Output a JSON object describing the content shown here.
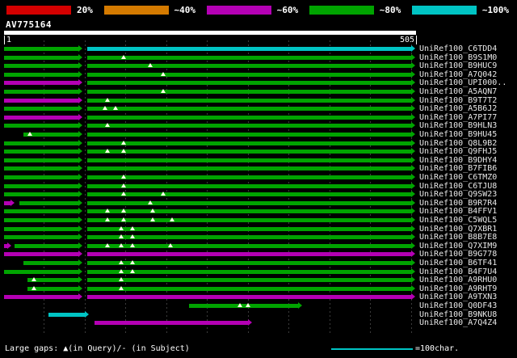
{
  "header": {
    "query_name": "AV775164"
  },
  "ruler": {
    "start": "1",
    "end": "505"
  },
  "legend": {
    "items": [
      {
        "label": "20%",
        "color": "#d40000"
      },
      {
        "label": "~40%",
        "color": "#d47a00"
      },
      {
        "label": "~60%",
        "color": "#b400b4"
      },
      {
        "label": "~80%",
        "color": "#00a400"
      },
      {
        "label": "~100%",
        "color": "#00c4c4"
      }
    ]
  },
  "footer": {
    "gaps_note": "Large gaps: ▲(in Query)/- (in Subject)",
    "scale_note": "=100char.",
    "scale_units": 100
  },
  "chart_data": {
    "type": "alignment-overview",
    "title": "BLAST hit overview",
    "query": {
      "name": "AV775164",
      "length": 505
    },
    "axis": {
      "min": 1,
      "max": 505,
      "gridlines": [
        50,
        100,
        150,
        200,
        250,
        300,
        350,
        400,
        450,
        500
      ]
    },
    "colors": {
      "green": "#00a400",
      "cyan": "#00c4c4",
      "magenta": "#b400b4"
    },
    "rows": [
      {
        "label": "UniRef100_C6TDD4",
        "segments": [
          {
            "from": 1,
            "to": 97,
            "color": "green"
          },
          {
            "from": 103,
            "to": 505,
            "color": "cyan"
          }
        ],
        "gaps": []
      },
      {
        "label": "UniRef100_B9S1M0",
        "segments": [
          {
            "from": 1,
            "to": 97,
            "color": "green"
          },
          {
            "from": 103,
            "to": 505,
            "color": "green"
          }
        ],
        "gaps": [
          148
        ]
      },
      {
        "label": "UniRef100_B9HUC9",
        "segments": [
          {
            "from": 1,
            "to": 97,
            "color": "green"
          },
          {
            "from": 103,
            "to": 505,
            "color": "green"
          }
        ],
        "gaps": [
          180
        ]
      },
      {
        "label": "UniRef100_A7Q042",
        "segments": [
          {
            "from": 1,
            "to": 97,
            "color": "green"
          },
          {
            "from": 103,
            "to": 505,
            "color": "green"
          }
        ],
        "gaps": [
          196
        ]
      },
      {
        "label": "UniRef100_UPI000..",
        "segments": [
          {
            "from": 1,
            "to": 97,
            "color": "magenta"
          },
          {
            "from": 103,
            "to": 505,
            "color": "green"
          }
        ],
        "gaps": []
      },
      {
        "label": "UniRef100_A5AQN7",
        "segments": [
          {
            "from": 1,
            "to": 97,
            "color": "green"
          },
          {
            "from": 103,
            "to": 505,
            "color": "green"
          }
        ],
        "gaps": [
          196
        ]
      },
      {
        "label": "UniRef100_B9T7T2",
        "segments": [
          {
            "from": 1,
            "to": 97,
            "color": "magenta"
          },
          {
            "from": 103,
            "to": 505,
            "color": "green"
          }
        ],
        "gaps": [
          128
        ]
      },
      {
        "label": "UniRef100_A5B6J2",
        "segments": [
          {
            "from": 1,
            "to": 97,
            "color": "green"
          },
          {
            "from": 103,
            "to": 505,
            "color": "green"
          }
        ],
        "gaps": [
          125,
          138
        ]
      },
      {
        "label": "UniRef100_A7PI77",
        "segments": [
          {
            "from": 1,
            "to": 97,
            "color": "magenta"
          },
          {
            "from": 103,
            "to": 505,
            "color": "green"
          }
        ],
        "gaps": []
      },
      {
        "label": "UniRef100_B9HLN3",
        "segments": [
          {
            "from": 1,
            "to": 97,
            "color": "green"
          },
          {
            "from": 103,
            "to": 505,
            "color": "green"
          }
        ],
        "gaps": [
          128
        ]
      },
      {
        "label": "UniRef100_B9HU45",
        "segments": [
          {
            "from": 25,
            "to": 97,
            "color": "green"
          },
          {
            "from": 103,
            "to": 505,
            "color": "green"
          }
        ],
        "gaps": [
          33
        ]
      },
      {
        "label": "UniRef100_Q8L9B2",
        "segments": [
          {
            "from": 1,
            "to": 97,
            "color": "green"
          },
          {
            "from": 103,
            "to": 505,
            "color": "green"
          }
        ],
        "gaps": [
          148
        ]
      },
      {
        "label": "UniRef100_Q9FHJ5",
        "segments": [
          {
            "from": 1,
            "to": 97,
            "color": "green"
          },
          {
            "from": 103,
            "to": 505,
            "color": "green"
          }
        ],
        "gaps": [
          128,
          148
        ]
      },
      {
        "label": "UniRef100_B9DHY4",
        "segments": [
          {
            "from": 1,
            "to": 97,
            "color": "green"
          },
          {
            "from": 103,
            "to": 505,
            "color": "green"
          }
        ],
        "gaps": []
      },
      {
        "label": "UniRef100_B7FIB6",
        "segments": [
          {
            "from": 1,
            "to": 97,
            "color": "green"
          },
          {
            "from": 103,
            "to": 505,
            "color": "green"
          }
        ],
        "gaps": []
      },
      {
        "label": "UniRef100_C6TMZ0",
        "segments": [
          {
            "from": 1,
            "to": 97,
            "color": "green"
          },
          {
            "from": 103,
            "to": 505,
            "color": "green"
          }
        ],
        "gaps": [
          148
        ]
      },
      {
        "label": "UniRef100_C6TJU8",
        "segments": [
          {
            "from": 1,
            "to": 97,
            "color": "green"
          },
          {
            "from": 103,
            "to": 505,
            "color": "green"
          }
        ],
        "gaps": [
          148
        ]
      },
      {
        "label": "UniRef100_Q9SW23",
        "segments": [
          {
            "from": 1,
            "to": 97,
            "color": "green"
          },
          {
            "from": 103,
            "to": 505,
            "color": "green"
          }
        ],
        "gaps": [
          148,
          196
        ]
      },
      {
        "label": "UniRef100_B9R7R4",
        "segments": [
          {
            "from": 1,
            "to": 14,
            "color": "magenta"
          },
          {
            "from": 20,
            "to": 97,
            "color": "green"
          },
          {
            "from": 103,
            "to": 505,
            "color": "green"
          }
        ],
        "gaps": [
          180
        ]
      },
      {
        "label": "UniRef100_B4FFV1",
        "segments": [
          {
            "from": 1,
            "to": 97,
            "color": "green"
          },
          {
            "from": 103,
            "to": 505,
            "color": "green"
          }
        ],
        "gaps": [
          128,
          148,
          183
        ]
      },
      {
        "label": "UniRef100_C5WQL5",
        "segments": [
          {
            "from": 1,
            "to": 97,
            "color": "green"
          },
          {
            "from": 103,
            "to": 505,
            "color": "green"
          }
        ],
        "gaps": [
          128,
          148,
          183,
          207
        ]
      },
      {
        "label": "UniRef100_Q7XBR1",
        "segments": [
          {
            "from": 1,
            "to": 97,
            "color": "green"
          },
          {
            "from": 103,
            "to": 505,
            "color": "green"
          }
        ],
        "gaps": [
          145,
          158
        ]
      },
      {
        "label": "UniRef100_B8B7E8",
        "segments": [
          {
            "from": 1,
            "to": 97,
            "color": "green"
          },
          {
            "from": 103,
            "to": 505,
            "color": "green"
          }
        ],
        "gaps": [
          145,
          158
        ]
      },
      {
        "label": "UniRef100_Q7XIM9",
        "segments": [
          {
            "from": 1,
            "to": 10,
            "color": "magenta"
          },
          {
            "from": 14,
            "to": 97,
            "color": "green"
          },
          {
            "from": 103,
            "to": 505,
            "color": "green"
          }
        ],
        "gaps": [
          128,
          145,
          158,
          205
        ]
      },
      {
        "label": "UniRef100_B9G778",
        "segments": [
          {
            "from": 1,
            "to": 97,
            "color": "magenta"
          },
          {
            "from": 103,
            "to": 505,
            "color": "magenta"
          }
        ],
        "gaps": []
      },
      {
        "label": "UniRef100_B6TF41",
        "segments": [
          {
            "from": 25,
            "to": 97,
            "color": "green"
          },
          {
            "from": 103,
            "to": 505,
            "color": "green"
          }
        ],
        "gaps": [
          145,
          158
        ]
      },
      {
        "label": "UniRef100_B4F7U4",
        "segments": [
          {
            "from": 1,
            "to": 97,
            "color": "green"
          },
          {
            "from": 103,
            "to": 505,
            "color": "green"
          }
        ],
        "gaps": [
          145,
          158
        ]
      },
      {
        "label": "UniRef100_A9RHU0",
        "segments": [
          {
            "from": 30,
            "to": 97,
            "color": "green"
          },
          {
            "from": 103,
            "to": 505,
            "color": "green"
          }
        ],
        "gaps": [
          38,
          145
        ]
      },
      {
        "label": "UniRef100_A9RHT9",
        "segments": [
          {
            "from": 30,
            "to": 97,
            "color": "green"
          },
          {
            "from": 103,
            "to": 505,
            "color": "green"
          }
        ],
        "gaps": [
          38,
          145
        ]
      },
      {
        "label": "UniRef100_A9TXN3",
        "segments": [
          {
            "from": 1,
            "to": 97,
            "color": "magenta"
          },
          {
            "from": 103,
            "to": 505,
            "color": "magenta"
          }
        ],
        "gaps": []
      },
      {
        "label": "UniRef100_Q0DF43",
        "segments": [
          {
            "from": 228,
            "to": 366,
            "color": "green"
          }
        ],
        "gaps": [
          290,
          300
        ]
      },
      {
        "label": "UniRef100_B9NKU8",
        "segments": [
          {
            "from": 55,
            "to": 105,
            "color": "cyan"
          }
        ],
        "gaps": []
      },
      {
        "label": "UniRef100_A7Q4Z4",
        "segments": [
          {
            "from": 112,
            "to": 305,
            "color": "magenta"
          }
        ],
        "gaps": []
      }
    ]
  }
}
